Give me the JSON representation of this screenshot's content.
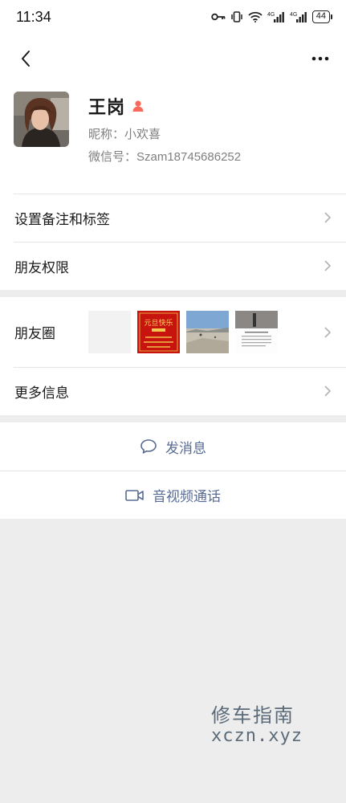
{
  "status_bar": {
    "time": "11:34",
    "network_1": "4G",
    "network_2": "4G",
    "battery": "44",
    "icons": [
      "key-icon",
      "vibrate-icon",
      "wifi-icon",
      "signal-4g-icon",
      "signal-4g-icon",
      "battery-icon"
    ]
  },
  "nav": {
    "back_icon": "chevron-left-icon",
    "more_icon": "more-dots-icon"
  },
  "profile": {
    "name": "王岗",
    "gender_icon": "person-icon",
    "nickname": "昵称：小欢喜",
    "wechat_id": "微信号：Szam18745686252",
    "accent_color": "#fa6a5b"
  },
  "menu": {
    "remark": "设置备注和标签",
    "permissions": "朋友权限",
    "moments": "朋友圈",
    "more_info": "更多信息"
  },
  "moments_thumbs": [
    {
      "name": "moment-thumb-blank"
    },
    {
      "name": "moment-thumb-new-year",
      "text": "元旦快乐"
    },
    {
      "name": "moment-thumb-beach"
    },
    {
      "name": "moment-thumb-article"
    }
  ],
  "actions": {
    "message": "发消息",
    "call": "音视频通话",
    "color": "#576b95"
  },
  "watermark": {
    "cn": "修车指南",
    "url": "xczn.xyz"
  }
}
